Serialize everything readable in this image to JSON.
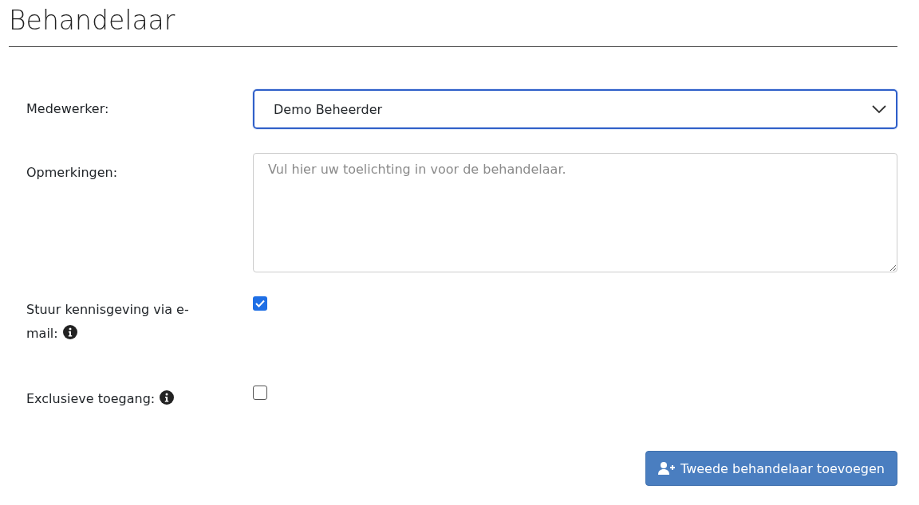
{
  "title": "Behandelaar",
  "fields": [
    {
      "kind": "select",
      "label": "Medewerker:",
      "value": "Demo Beheerder",
      "info": false
    },
    {
      "kind": "textarea",
      "label": "Opmerkingen:",
      "placeholder": "Vul hier uw toelichting in voor de behandelaar.",
      "info": false
    },
    {
      "kind": "checkbox",
      "label": "Stuur kennisgeving via e-mail:",
      "checked": true,
      "info": true
    },
    {
      "kind": "checkbox",
      "label": "Exclusieve toegang:",
      "checked": false,
      "info": true
    }
  ],
  "button": {
    "label": "Tweede behandelaar toevoegen"
  }
}
